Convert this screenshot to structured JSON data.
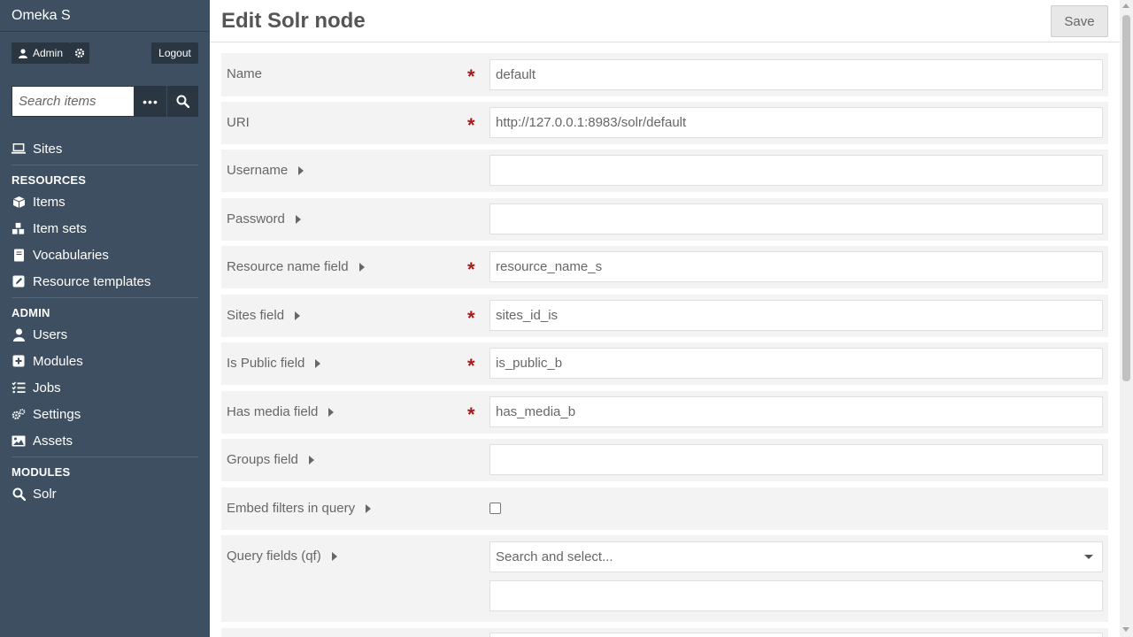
{
  "app": {
    "brand": "Omeka S"
  },
  "user": {
    "name": "Admin",
    "logout_label": "Logout"
  },
  "search": {
    "placeholder": "Search items",
    "advanced_label": "•••"
  },
  "nav": {
    "sites": "Sites",
    "resources_heading": "RESOURCES",
    "resources": [
      "Items",
      "Item sets",
      "Vocabularies",
      "Resource templates"
    ],
    "admin_heading": "ADMIN",
    "admin": [
      "Users",
      "Modules",
      "Jobs",
      "Settings",
      "Assets"
    ],
    "modules_heading": "MODULES",
    "modules": [
      "Solr"
    ]
  },
  "page": {
    "title": "Edit Solr node",
    "save_label": "Save"
  },
  "form": {
    "fields": [
      {
        "label": "Name",
        "required": true,
        "value": "default",
        "type": "text",
        "has_info": false
      },
      {
        "label": "URI",
        "required": true,
        "value": "http://127.0.0.1:8983/solr/default",
        "type": "text",
        "has_info": false
      },
      {
        "label": "Username",
        "required": false,
        "value": "",
        "type": "text",
        "has_info": true
      },
      {
        "label": "Password",
        "required": false,
        "value": "",
        "type": "text",
        "has_info": true
      },
      {
        "label": "Resource name field",
        "required": true,
        "value": "resource_name_s",
        "type": "text",
        "has_info": true
      },
      {
        "label": "Sites field",
        "required": true,
        "value": "sites_id_is",
        "type": "text",
        "has_info": true
      },
      {
        "label": "Is Public field",
        "required": true,
        "value": "is_public_b",
        "type": "text",
        "has_info": true
      },
      {
        "label": "Has media field",
        "required": true,
        "value": "has_media_b",
        "type": "text",
        "has_info": true
      },
      {
        "label": "Groups field",
        "required": false,
        "value": "",
        "type": "text",
        "has_info": true
      },
      {
        "label": "Embed filters in query",
        "required": false,
        "value": false,
        "type": "checkbox",
        "has_info": true
      },
      {
        "label": "Query fields (qf)",
        "required": false,
        "value": "",
        "type": "select",
        "placeholder": "Search and select...",
        "has_info": true
      }
    ]
  },
  "colors": {
    "sidebar": "#3d4f61",
    "required": "#a91919",
    "field_bg": "#f3f3f3"
  },
  "icons": {
    "user": "user-icon",
    "gear": "gear-icon",
    "search": "search-icon",
    "sites": "laptop-icon",
    "items": "cube-icon",
    "item_sets": "cubes-icon",
    "vocabularies": "book-icon",
    "templates": "edit-icon",
    "users": "user-icon",
    "modules": "plus-square-icon",
    "jobs": "tasks-icon",
    "settings": "cogs-icon",
    "assets": "image-icon",
    "solr": "search-icon"
  }
}
